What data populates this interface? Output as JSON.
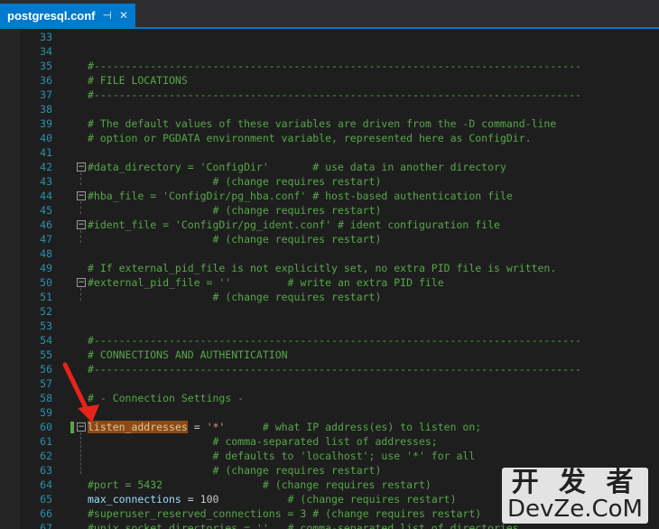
{
  "tab": {
    "title": "postgresql.conf",
    "pin": "⊣",
    "close": "✕"
  },
  "colors": {
    "accent": "#007acc",
    "comment": "#57a64a",
    "keyword": "#9cdcfe",
    "string": "#d69d85",
    "line_number": "#2b91af"
  },
  "lines": [
    {
      "n": "33",
      "t": ""
    },
    {
      "n": "34",
      "t": ""
    },
    {
      "n": "35",
      "t": "#------------------------------------------------------------------------------",
      "c": "cm"
    },
    {
      "n": "36",
      "t": "# FILE LOCATIONS",
      "c": "cm"
    },
    {
      "n": "37",
      "t": "#------------------------------------------------------------------------------",
      "c": "cm"
    },
    {
      "n": "38",
      "t": ""
    },
    {
      "n": "39",
      "t": "# The default values of these variables are driven from the -D command-line",
      "c": "cm"
    },
    {
      "n": "40",
      "t": "# option or PGDATA environment variable, represented here as ConfigDir.",
      "c": "cm"
    },
    {
      "n": "41",
      "t": ""
    },
    {
      "n": "42",
      "t": "#data_directory = 'ConfigDir'       # use data in another directory",
      "c": "cm",
      "fold": true
    },
    {
      "n": "43",
      "t": "                    # (change requires restart)",
      "c": "cm"
    },
    {
      "n": "44",
      "t": "#hba_file = 'ConfigDir/pg_hba.conf' # host-based authentication file",
      "c": "cm",
      "fold": true
    },
    {
      "n": "45",
      "t": "                    # (change requires restart)",
      "c": "cm"
    },
    {
      "n": "46",
      "t": "#ident_file = 'ConfigDir/pg_ident.conf' # ident configuration file",
      "c": "cm",
      "fold": true
    },
    {
      "n": "47",
      "t": "                    # (change requires restart)",
      "c": "cm"
    },
    {
      "n": "48",
      "t": ""
    },
    {
      "n": "49",
      "t": "# If external_pid_file is not explicitly set, no extra PID file is written.",
      "c": "cm"
    },
    {
      "n": "50",
      "t": "#external_pid_file = ''         # write an extra PID file",
      "c": "cm",
      "fold": true
    },
    {
      "n": "51",
      "t": "                    # (change requires restart)",
      "c": "cm"
    },
    {
      "n": "52",
      "t": ""
    },
    {
      "n": "53",
      "t": ""
    },
    {
      "n": "54",
      "t": "#------------------------------------------------------------------------------",
      "c": "cm"
    },
    {
      "n": "55",
      "t": "# CONNECTIONS AND AUTHENTICATION",
      "c": "cm"
    },
    {
      "n": "56",
      "t": "#------------------------------------------------------------------------------",
      "c": "cm"
    },
    {
      "n": "57",
      "t": ""
    },
    {
      "n": "58",
      "t": "# - Connection Settings -",
      "c": "cm"
    },
    {
      "n": "59",
      "t": ""
    },
    {
      "n": "60",
      "special": "listen"
    },
    {
      "n": "61",
      "t": "                    # comma-separated list of addresses;",
      "c": "cm"
    },
    {
      "n": "62",
      "t": "                    # defaults to 'localhost'; use '*' for all",
      "c": "cm"
    },
    {
      "n": "63",
      "t": "                    # (change requires restart)",
      "c": "cm"
    },
    {
      "n": "64",
      "t": "#port = 5432                # (change requires restart)",
      "c": "cm"
    },
    {
      "n": "65",
      "special": "maxconn"
    },
    {
      "n": "66",
      "t": "#superuser_reserved_connections = 3 # (change requires restart)",
      "c": "cm"
    },
    {
      "n": "67",
      "t": "#unix_socket_directories = ''   # comma-separated list of directories",
      "c": "cm"
    }
  ],
  "listen": {
    "key": "listen_addresses",
    "eq": " = ",
    "val": "'*'",
    "comment": "      # what IP address(es) to listen on;"
  },
  "maxconn": {
    "key": "max_connections",
    "eq": " = ",
    "val": "100",
    "comment": "           # (change requires restart)"
  },
  "watermark": {
    "cn": "开 发 者",
    "en": "DevZe.CoM"
  }
}
